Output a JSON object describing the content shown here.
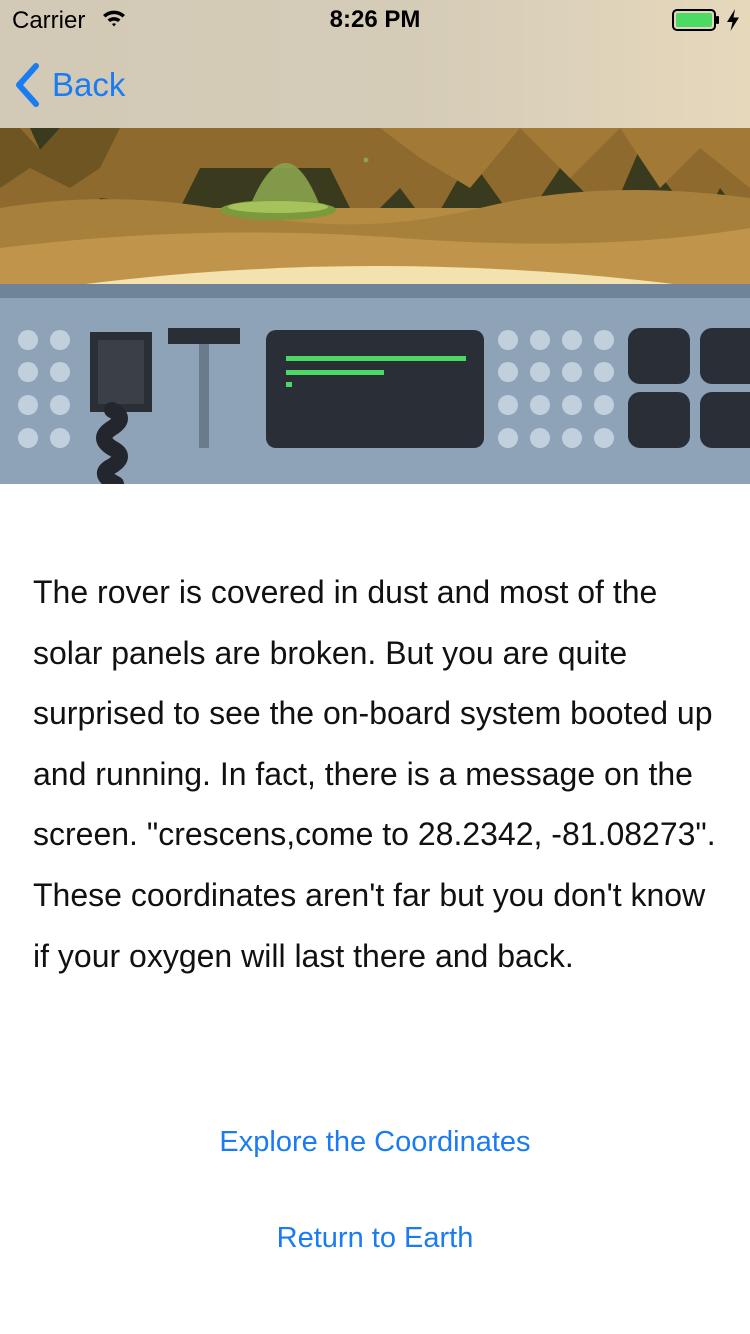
{
  "status_bar": {
    "carrier": "Carrier",
    "time": "8:26 PM",
    "battery_color": "#4cd964",
    "icons": [
      "wifi-icon",
      "battery-icon",
      "charging-icon"
    ]
  },
  "nav": {
    "back_label": "Back",
    "accent_color": "#1a7bf2"
  },
  "story": {
    "text": "The rover is covered in dust and most of the solar panels are broken. But you are quite surprised to see the on-board system booted up and running. In fact, there is a message on the screen. \"crescens,come to 28.2342, -81.08273\". These coordinates aren't far but you don't know if your oxygen will last there and back."
  },
  "choices": [
    {
      "label": "Explore the Coordinates"
    },
    {
      "label": "Return to Earth"
    }
  ]
}
